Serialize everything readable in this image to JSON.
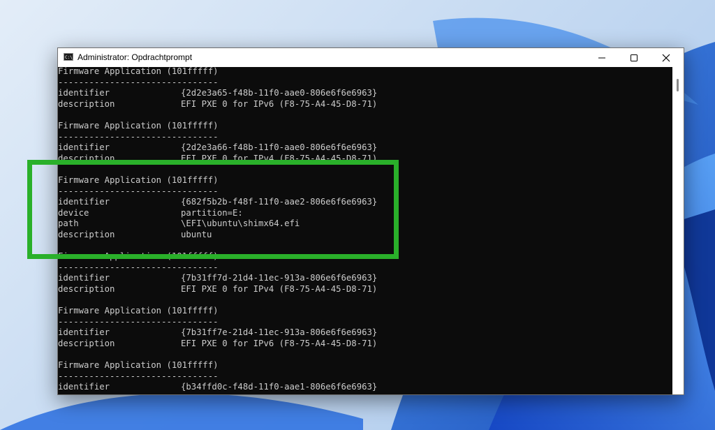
{
  "window": {
    "title": "Administrator: Opdrachtprompt",
    "icon_text": "C:\\_"
  },
  "console": {
    "lines": [
      {
        "type": "text",
        "text": "Firmware Application (101fffff)"
      },
      {
        "type": "text",
        "text": "-------------------------------"
      },
      {
        "type": "kv",
        "key": "identifier",
        "value": "{2d2e3a65-f48b-11f0-aae0-806e6f6e6963}"
      },
      {
        "type": "kv",
        "key": "description",
        "value": "EFI PXE 0 for IPv6 (F8-75-A4-45-D8-71)"
      },
      {
        "type": "blank"
      },
      {
        "type": "text",
        "text": "Firmware Application (101fffff)"
      },
      {
        "type": "text",
        "text": "-------------------------------"
      },
      {
        "type": "kv",
        "key": "identifier",
        "value": "{2d2e3a66-f48b-11f0-aae0-806e6f6e6963}"
      },
      {
        "type": "kv",
        "key": "description",
        "value": "EFI PXE 0 for IPv4 (F8-75-A4-45-D8-71)"
      },
      {
        "type": "blank"
      },
      {
        "type": "text",
        "text": "Firmware Application (101fffff)"
      },
      {
        "type": "text",
        "text": "-------------------------------"
      },
      {
        "type": "kv",
        "key": "identifier",
        "value": "{682f5b2b-f48f-11f0-aae2-806e6f6e6963}"
      },
      {
        "type": "kv",
        "key": "device",
        "value": "partition=E:"
      },
      {
        "type": "kv",
        "key": "path",
        "value": "\\EFI\\ubuntu\\shimx64.efi"
      },
      {
        "type": "kv",
        "key": "description",
        "value": "ubuntu"
      },
      {
        "type": "blank"
      },
      {
        "type": "text",
        "text": "Firmware Application (101fffff)"
      },
      {
        "type": "text",
        "text": "-------------------------------"
      },
      {
        "type": "kv",
        "key": "identifier",
        "value": "{7b31ff7d-21d4-11ec-913a-806e6f6e6963}"
      },
      {
        "type": "kv",
        "key": "description",
        "value": "EFI PXE 0 for IPv4 (F8-75-A4-45-D8-71)"
      },
      {
        "type": "blank"
      },
      {
        "type": "text",
        "text": "Firmware Application (101fffff)"
      },
      {
        "type": "text",
        "text": "-------------------------------"
      },
      {
        "type": "kv",
        "key": "identifier",
        "value": "{7b31ff7e-21d4-11ec-913a-806e6f6e6963}"
      },
      {
        "type": "kv",
        "key": "description",
        "value": "EFI PXE 0 for IPv6 (F8-75-A4-45-D8-71)"
      },
      {
        "type": "blank"
      },
      {
        "type": "text",
        "text": "Firmware Application (101fffff)"
      },
      {
        "type": "text",
        "text": "-------------------------------"
      },
      {
        "type": "kv",
        "key": "identifier",
        "value": "{b34ffd0c-f48d-11f0-aae1-806e6f6e6963}"
      }
    ]
  },
  "colors": {
    "console_background": "#0c0c0c",
    "console_text": "#cccccc",
    "highlight_border": "#2ab02a",
    "wallpaper_accent": "#1f5fd1"
  },
  "icons": {
    "app": "cmd-app-icon",
    "minimize": "minimize-icon",
    "maximize": "maximize-icon",
    "close": "close-icon"
  }
}
